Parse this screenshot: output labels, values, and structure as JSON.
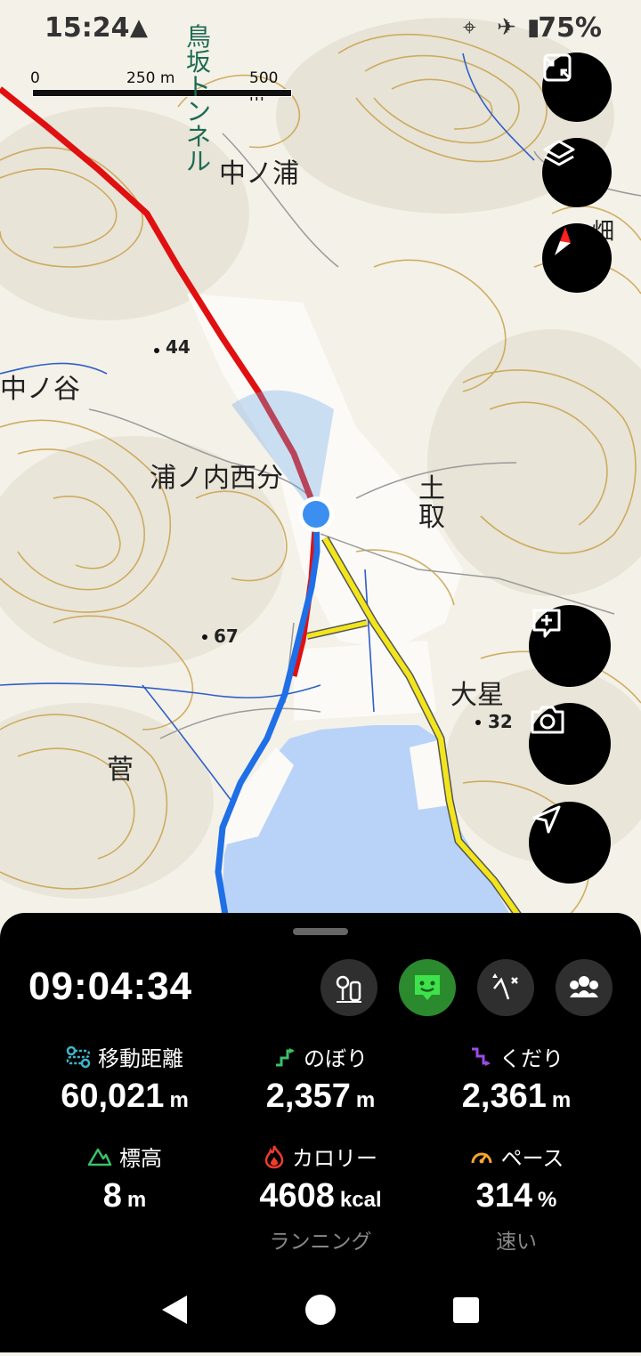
{
  "status_bar": {
    "time": "15:24",
    "battery": "75%",
    "icons": [
      "navigation-arrow-icon",
      "location-pin-icon",
      "airplane-icon",
      "battery-icon"
    ]
  },
  "map": {
    "scale": {
      "labels": [
        "0",
        "250 m",
        "500 m"
      ]
    },
    "labels": {
      "tunnel": "鳥坂トンネル",
      "nakanoura": "中ノ浦",
      "nakanotani": "中ノ谷",
      "elev44": "44",
      "uranouchi": "浦ノ内西分",
      "elev67": "67",
      "toritori": "土取",
      "ohboshi": "大星",
      "elev32": "32",
      "suga": "菅",
      "edge": "畑"
    },
    "colors": {
      "route_red": "#e01010",
      "track_blue": "#1f6fe6",
      "road_yellow": "#f2e51c",
      "water": "#b9d3f8",
      "contour": "#c9a24c"
    }
  },
  "controls": {
    "icons": [
      "exit-fullscreen-icon",
      "layers-icon",
      "compass-icon",
      "add-memo-icon",
      "camera-icon",
      "navigate-icon"
    ]
  },
  "panel": {
    "elapsed_time": "09:04:34",
    "mode_buttons": [
      "waypoint-icon",
      "face-status-icon",
      "route-icon",
      "group-icon"
    ],
    "stats": {
      "distance": {
        "label": "移動距離",
        "value": "60,021",
        "unit": "m"
      },
      "ascent": {
        "label": "のぼり",
        "value": "2,357",
        "unit": "m"
      },
      "descent": {
        "label": "くだり",
        "value": "2,361",
        "unit": "m"
      },
      "altitude": {
        "label": "標高",
        "value": "8",
        "unit": "m"
      },
      "calories": {
        "label": "カロリー",
        "value": "4608",
        "unit": "kcal",
        "sub": "ランニング"
      },
      "pace": {
        "label": "ペース",
        "value": "314",
        "unit": "%",
        "sub": "速い"
      }
    },
    "colors": {
      "distance": "#3fb6c9",
      "ascent": "#3cc06a",
      "descent": "#9b4de3",
      "altitude": "#3cc06a",
      "calories": "#ef3b2d",
      "pace": "#f2a531"
    }
  },
  "system_nav": {
    "buttons": [
      "back-icon",
      "home-icon",
      "recents-icon"
    ]
  }
}
